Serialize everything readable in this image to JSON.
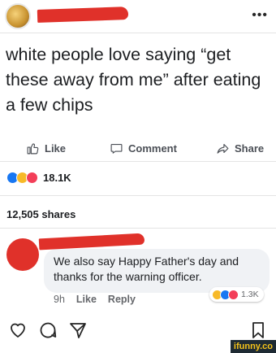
{
  "header": {
    "more_icon": "more-horizontal-icon",
    "more_glyph": "•••"
  },
  "post": {
    "text": "white people love saying “get these away from me” after eating a few chips"
  },
  "actions": {
    "like_label": "Like",
    "comment_label": "Comment",
    "share_label": "Share"
  },
  "stats": {
    "reaction_count": "18.1K",
    "shares": "12,505 shares"
  },
  "comment": {
    "text": "We also say Happy Father's day and thanks for the warning officer.",
    "time": "9h",
    "like_label": "Like",
    "reply_label": "Reply",
    "reaction_count": "1.3K"
  },
  "watermark": {
    "text": "ifunny.co"
  },
  "colors": {
    "redaction": "#e0312a",
    "like_blue": "#1877f2",
    "haha_yellow": "#f7b928",
    "love_red": "#f33e58",
    "watermark_yellow": "#f4c21a"
  }
}
